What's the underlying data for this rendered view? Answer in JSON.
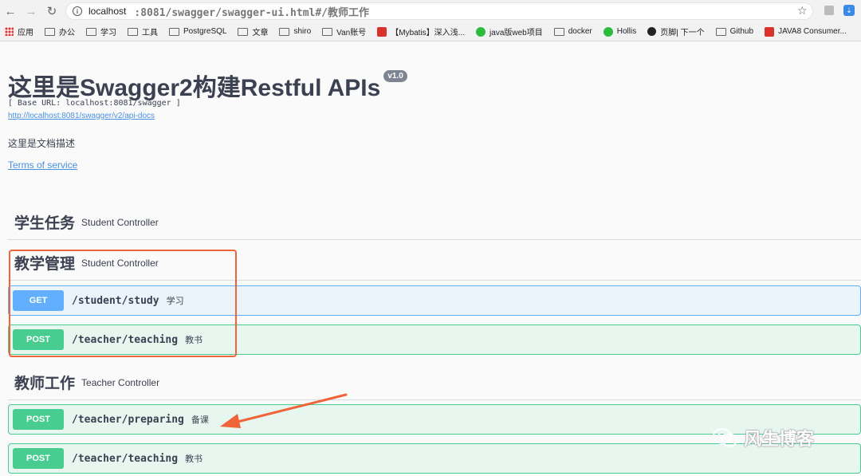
{
  "browser": {
    "url_host": "localhost",
    "url_path": ":8081/swagger/swagger-ui.html#/教师工作",
    "bookmarks": [
      "应用",
      "办公",
      "学习",
      "工具",
      "PostgreSQL",
      "文章",
      "shiro",
      "Van账号",
      "【Mybatis】深入浅...",
      "java版web项目",
      "docker",
      "Hollis",
      "页脚| 下一个",
      "Github",
      "JAVA8 Consumer..."
    ]
  },
  "info": {
    "title": "这里是Swagger2构建Restful APIs",
    "version": "v1.0",
    "base_url": "[ Base URL: localhost:8081/swagger ]",
    "docs_link": "http://localhost:8081/swagger/v2/api-docs",
    "description": "这里是文档描述",
    "terms": "Terms of service"
  },
  "sections": [
    {
      "name": "学生任务",
      "sub": "Student Controller"
    },
    {
      "name": "教学管理",
      "sub": "Student Controller"
    },
    {
      "name": "教师工作",
      "sub": "Teacher Controller"
    }
  ],
  "operations": [
    {
      "method": "GET",
      "path": "/student/study",
      "summary": "学习"
    },
    {
      "method": "POST",
      "path": "/teacher/teaching",
      "summary": "教书"
    },
    {
      "method": "POST",
      "path": "/teacher/preparing",
      "summary": "备课"
    },
    {
      "method": "POST",
      "path": "/teacher/teaching",
      "summary": "教书"
    }
  ],
  "watermark": "风生博客",
  "colors": {
    "get": "#61affe",
    "post": "#49cc90",
    "highlight": "#f0643a"
  }
}
